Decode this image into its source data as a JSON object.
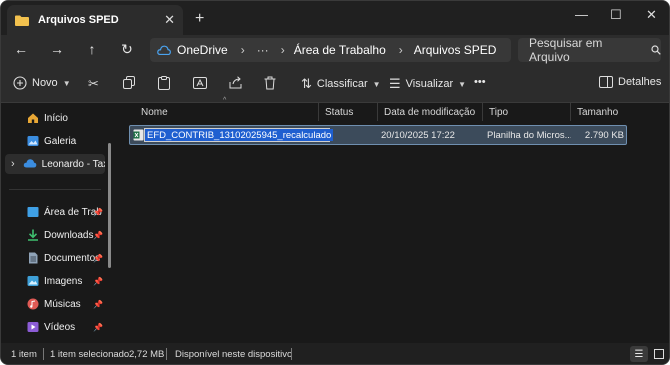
{
  "window": {
    "tab_title": "Arquivos SPED",
    "tab_close": "✕",
    "new_tab": "+",
    "controls": {
      "minimize": "—",
      "maximize": "☐",
      "close": "✕"
    }
  },
  "nav": {
    "back": "←",
    "forward": "→",
    "up": "↑",
    "refresh": "↻",
    "breadcrumb": [
      "OneDrive",
      "Área de Trabalho",
      "Arquivos SPED"
    ],
    "separator": "›",
    "more": "···",
    "search_placeholder": "Pesquisar em Arquivo"
  },
  "toolbar": {
    "new_label": "Novo",
    "sort_label": "Classificar",
    "view_label": "Visualizar",
    "more": "•••",
    "details_label": "Detalhes"
  },
  "sidebar": {
    "items": [
      {
        "label": "Início",
        "icon": "home-icon",
        "color": "#e8a735",
        "pinned": false
      },
      {
        "label": "Galeria",
        "icon": "gallery-icon",
        "color": "#3b8de0",
        "pinned": false
      },
      {
        "label": "Leonardo - Taxc",
        "icon": "onedrive-icon",
        "color": "#3b8de0",
        "pinned": false
      },
      {
        "label": "Área de Trab",
        "icon": "desktop-icon",
        "color": "#3fa0e6",
        "pinned": true
      },
      {
        "label": "Downloads",
        "icon": "download-icon",
        "color": "#3fbf6f",
        "pinned": true
      },
      {
        "label": "Documentos",
        "icon": "documents-icon",
        "color": "#8fa3b8",
        "pinned": true
      },
      {
        "label": "Imagens",
        "icon": "pictures-icon",
        "color": "#3ea0d8",
        "pinned": true
      },
      {
        "label": "Músicas",
        "icon": "music-icon",
        "color": "#e05a55",
        "pinned": true
      },
      {
        "label": "Vídeos",
        "icon": "videos-icon",
        "color": "#8c5cd6",
        "pinned": true
      }
    ],
    "pin_glyph": "📌",
    "expand_glyph": "›"
  },
  "columns": [
    "Nome",
    "Status",
    "Data de modificação",
    "Tipo",
    "Tamanho"
  ],
  "files": [
    {
      "name": "EFD_CONTRIB_13102025945_recalculado",
      "status": "",
      "modified": "20/10/2025 17:22",
      "type": "Planilha do Micros...",
      "size": "2.790 KB",
      "icon": "excel-icon"
    }
  ],
  "status": {
    "count": "1 item",
    "selected": "1 item selecionado",
    "selected_size": "2,72 MB",
    "availability": "Disponível neste dispositivo"
  },
  "colors": {
    "accent": "#1f5fd0",
    "selection_bg": "#3c4b5b",
    "window_bg": "#191919"
  }
}
